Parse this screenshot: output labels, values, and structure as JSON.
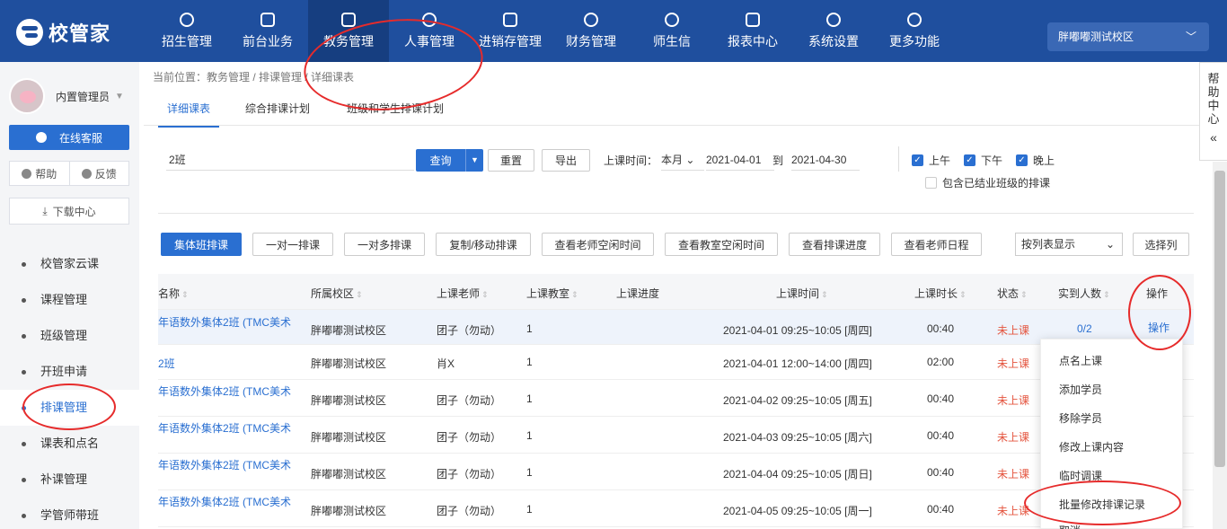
{
  "brand": {
    "name": "校管家"
  },
  "nav": [
    {
      "label": "招生管理"
    },
    {
      "label": "前台业务"
    },
    {
      "label": "教务管理"
    },
    {
      "label": "人事管理"
    },
    {
      "label": "进销存管理"
    },
    {
      "label": "财务管理"
    },
    {
      "label": "师生信"
    },
    {
      "label": "报表中心"
    },
    {
      "label": "系统设置"
    },
    {
      "label": "更多功能"
    }
  ],
  "campus": {
    "selected": "胖嘟嘟测试校区"
  },
  "sidebar": {
    "user_name": "内置管理员",
    "online_service": "在线客服",
    "help": "帮助",
    "feedback": "反馈",
    "download": "下载中心",
    "menu": [
      {
        "label": "校管家云课"
      },
      {
        "label": "课程管理"
      },
      {
        "label": "班级管理"
      },
      {
        "label": "开班申请"
      },
      {
        "label": "排课管理"
      },
      {
        "label": "课表和点名"
      },
      {
        "label": "补课管理"
      },
      {
        "label": "学管师带班"
      }
    ]
  },
  "breadcrumb": "当前位置：教务管理 / 排课管理 / 详细课表",
  "tabs": [
    {
      "label": "详细课表"
    },
    {
      "label": "综合排课计划"
    },
    {
      "label": "班级和学生排课计划"
    }
  ],
  "filter": {
    "search_value": "2班",
    "query": "查询",
    "reset": "重置",
    "export": "导出",
    "time_label": "上课时间：",
    "month": "本月",
    "date_from": "2021-04-01",
    "to": "到",
    "date_to": "2021-04-30",
    "morning": "上午",
    "afternoon": "下午",
    "evening": "晚上",
    "include_finished": "包含已结业班级的排课"
  },
  "actions": [
    {
      "label": "集体班排课"
    },
    {
      "label": "一对一排课"
    },
    {
      "label": "一对多排课"
    },
    {
      "label": "复制/移动排课"
    },
    {
      "label": "查看老师空闲时间"
    },
    {
      "label": "查看教室空闲时间"
    },
    {
      "label": "查看排课进度"
    },
    {
      "label": "查看老师日程"
    }
  ],
  "view": {
    "mode": "按列表显示",
    "choose_columns": "选择列"
  },
  "table": {
    "headers": {
      "name": "名称",
      "campus": "所属校区",
      "teacher": "上课老师",
      "room": "上课教室",
      "progress": "上课进度",
      "time": "上课时间",
      "duration": "上课时长",
      "status": "状态",
      "attendance": "实到人数",
      "ops": "操作"
    },
    "rows": [
      {
        "name": "年语数外集体2班 (TMC美术",
        "campus": "胖嘟嘟测试校区",
        "teacher": "团子（勿动）",
        "room": "1",
        "time": "2021-04-01 09:25~10:05 [周四]",
        "duration": "00:40",
        "status": "未上课",
        "attendance": "0/2",
        "op": "操作"
      },
      {
        "name": "2班",
        "campus": "胖嘟嘟测试校区",
        "teacher": "肖X",
        "room": "1",
        "time": "2021-04-01 12:00~14:00 [周四]",
        "duration": "02:00",
        "status": "未上课",
        "attendance": "",
        "op": ""
      },
      {
        "name": "年语数外集体2班 (TMC美术",
        "campus": "胖嘟嘟测试校区",
        "teacher": "团子（勿动）",
        "room": "1",
        "time": "2021-04-02 09:25~10:05 [周五]",
        "duration": "00:40",
        "status": "未上课",
        "attendance": "",
        "op": ""
      },
      {
        "name": "年语数外集体2班 (TMC美术",
        "campus": "胖嘟嘟测试校区",
        "teacher": "团子（勿动）",
        "room": "1",
        "time": "2021-04-03 09:25~10:05 [周六]",
        "duration": "00:40",
        "status": "未上课",
        "attendance": "",
        "op": ""
      },
      {
        "name": "年语数外集体2班 (TMC美术",
        "campus": "胖嘟嘟测试校区",
        "teacher": "团子（勿动）",
        "room": "1",
        "time": "2021-04-04 09:25~10:05 [周日]",
        "duration": "00:40",
        "status": "未上课",
        "attendance": "",
        "op": ""
      },
      {
        "name": "年语数外集体2班 (TMC美术",
        "campus": "胖嘟嘟测试校区",
        "teacher": "团子（勿动）",
        "room": "1",
        "time": "2021-04-05 09:25~10:05 [周一]",
        "duration": "00:40",
        "status": "未上课",
        "attendance": "",
        "op": ""
      }
    ]
  },
  "op_menu": [
    {
      "label": "点名上课"
    },
    {
      "label": "添加学员"
    },
    {
      "label": "移除学员"
    },
    {
      "label": "修改上课内容"
    },
    {
      "label": "临时调课"
    },
    {
      "label": "批量修改排课记录"
    },
    {
      "label": "取消"
    }
  ],
  "help_center": {
    "label": "帮助中心"
  },
  "colors": {
    "nav_bg": "#1f4f9e",
    "primary": "#2a6fd1",
    "status_red": "#e4543e",
    "annotation": "#e62b2b"
  }
}
